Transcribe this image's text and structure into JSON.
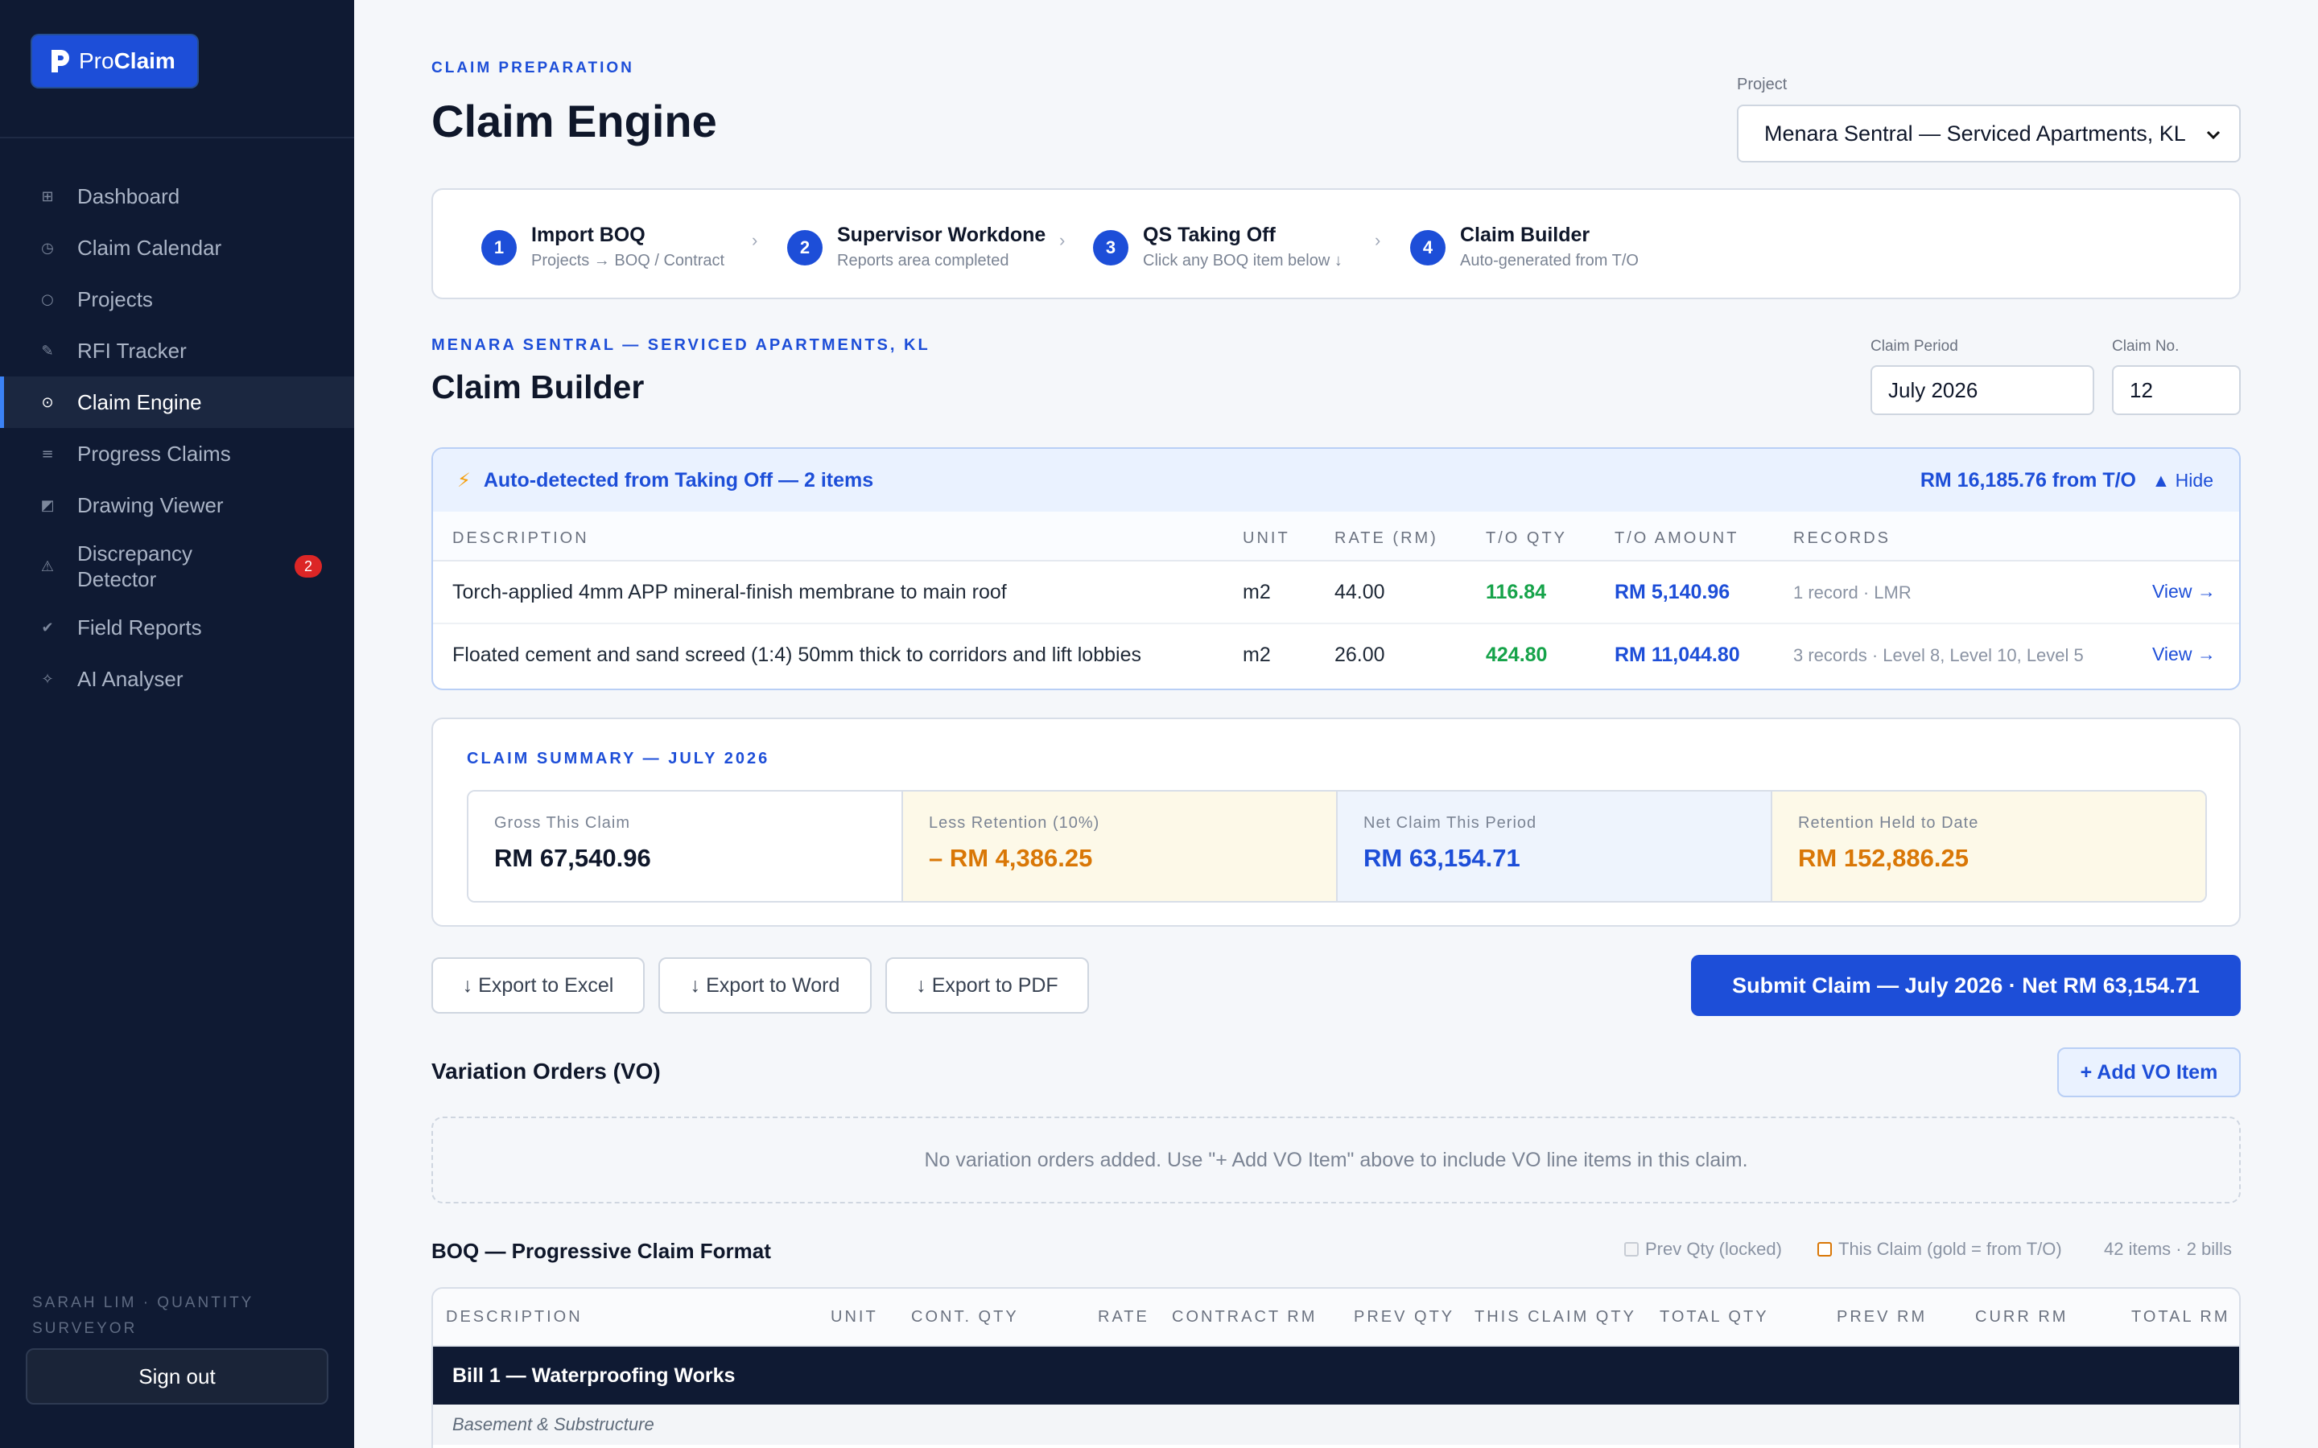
{
  "brand": {
    "name_prefix": "Pro",
    "name_suffix": "Claim"
  },
  "sidebar": {
    "items": [
      {
        "label": "Dashboard",
        "icon": "grid-icon",
        "glyph": "⊞"
      },
      {
        "label": "Claim Calendar",
        "icon": "clock-icon",
        "glyph": "◷"
      },
      {
        "label": "Projects",
        "icon": "circle-icon",
        "glyph": "○"
      },
      {
        "label": "RFI Tracker",
        "icon": "pencil-icon",
        "glyph": "✎"
      },
      {
        "label": "Claim Engine",
        "icon": "target-icon",
        "glyph": "⊙",
        "active": true
      },
      {
        "label": "Progress Claims",
        "icon": "list-icon",
        "glyph": "≡"
      },
      {
        "label": "Drawing Viewer",
        "icon": "drawing-icon",
        "glyph": "◩"
      },
      {
        "label": "Discrepancy Detector",
        "icon": "warning-icon",
        "glyph": "⚠",
        "badge": "2"
      },
      {
        "label": "Field Reports",
        "icon": "check-icon",
        "glyph": "✔"
      },
      {
        "label": "AI Analyser",
        "icon": "sparkle-icon",
        "glyph": "✧"
      }
    ],
    "user": "SARAH LIM · QUANTITY SURVEYOR",
    "signout": "Sign out"
  },
  "header": {
    "eyebrow": "CLAIM PREPARATION",
    "title": "Claim Engine",
    "project_label": "Project",
    "project_value": "Menara Sentral — Serviced Apartments, KL"
  },
  "steps": [
    {
      "num": "1",
      "title": "Import BOQ",
      "sub": "Projects → BOQ / Contract"
    },
    {
      "num": "2",
      "title": "Supervisor Workdone",
      "sub": "Reports area completed"
    },
    {
      "num": "3",
      "title": "QS Taking Off",
      "sub": "Click any BOQ item below ↓"
    },
    {
      "num": "4",
      "title": "Claim Builder",
      "sub": "Auto-generated from T/O"
    }
  ],
  "builder": {
    "eyebrow": "MENARA SENTRAL — SERVICED APARTMENTS, KL",
    "title": "Claim Builder",
    "period_label": "Claim Period",
    "period_value": "July 2026",
    "no_label": "Claim No.",
    "no_value": "12"
  },
  "auto": {
    "title": "Auto-detected from Taking Off — 2 items",
    "amount": "RM 16,185.76 from T/O",
    "hide": "▲ Hide",
    "columns": [
      "DESCRIPTION",
      "UNIT",
      "RATE (RM)",
      "T/O QTY",
      "T/O AMOUNT",
      "RECORDS"
    ],
    "rows": [
      {
        "desc": "Torch-applied 4mm APP mineral-finish membrane to main roof",
        "unit": "m2",
        "rate": "44.00",
        "qty": "116.84",
        "amount": "RM 5,140.96",
        "records": "1 record · LMR",
        "action": "View →"
      },
      {
        "desc": "Floated cement and sand screed (1:4) 50mm thick to corridors and lift lobbies",
        "unit": "m2",
        "rate": "26.00",
        "qty": "424.80",
        "amount": "RM 11,044.80",
        "records": "3 records · Level 8, Level 10, Level 5",
        "action": "View →"
      }
    ]
  },
  "summary": {
    "title": "CLAIM SUMMARY — JULY 2026",
    "cards": [
      {
        "label": "Gross This Claim",
        "value": "RM 67,540.96",
        "bg": "#ffffff",
        "color": "#0f172a"
      },
      {
        "label": "Less Retention (10%)",
        "value": "– RM 4,386.25",
        "bg": "#fdf9e8",
        "color": "#d97706"
      },
      {
        "label": "Net Claim This Period",
        "value": "RM 63,154.71",
        "bg": "#eef4fd",
        "color": "#1d4ed8"
      },
      {
        "label": "Retention Held to Date",
        "value": "RM 152,886.25",
        "bg": "#fdf9e8",
        "color": "#d97706"
      }
    ]
  },
  "actions": {
    "excel": "↓ Export to Excel",
    "word": "↓ Export to Word",
    "pdf": "↓ Export to PDF",
    "submit": "Submit Claim — July 2026 · Net RM 63,154.71"
  },
  "vo": {
    "title": "Variation Orders (VO)",
    "add": "+ Add VO Item",
    "empty": "No variation orders added. Use \"+ Add VO Item\" above to include VO line items in this claim."
  },
  "boq": {
    "title": "BOQ — Progressive Claim Format",
    "legend_prev": "Prev Qty (locked)",
    "legend_this": "This Claim (gold = from T/O)",
    "count": "42 items · 2 bills",
    "columns": [
      "DESCRIPTION",
      "UNIT",
      "CONT. QTY",
      "RATE",
      "CONTRACT RM",
      "PREV QTY",
      "THIS CLAIM QTY",
      "TOTAL QTY",
      "PREV RM",
      "CURR RM",
      "TOTAL RM"
    ],
    "bill": "Bill 1 — Waterproofing Works",
    "subhead": "Basement & Substructure"
  }
}
